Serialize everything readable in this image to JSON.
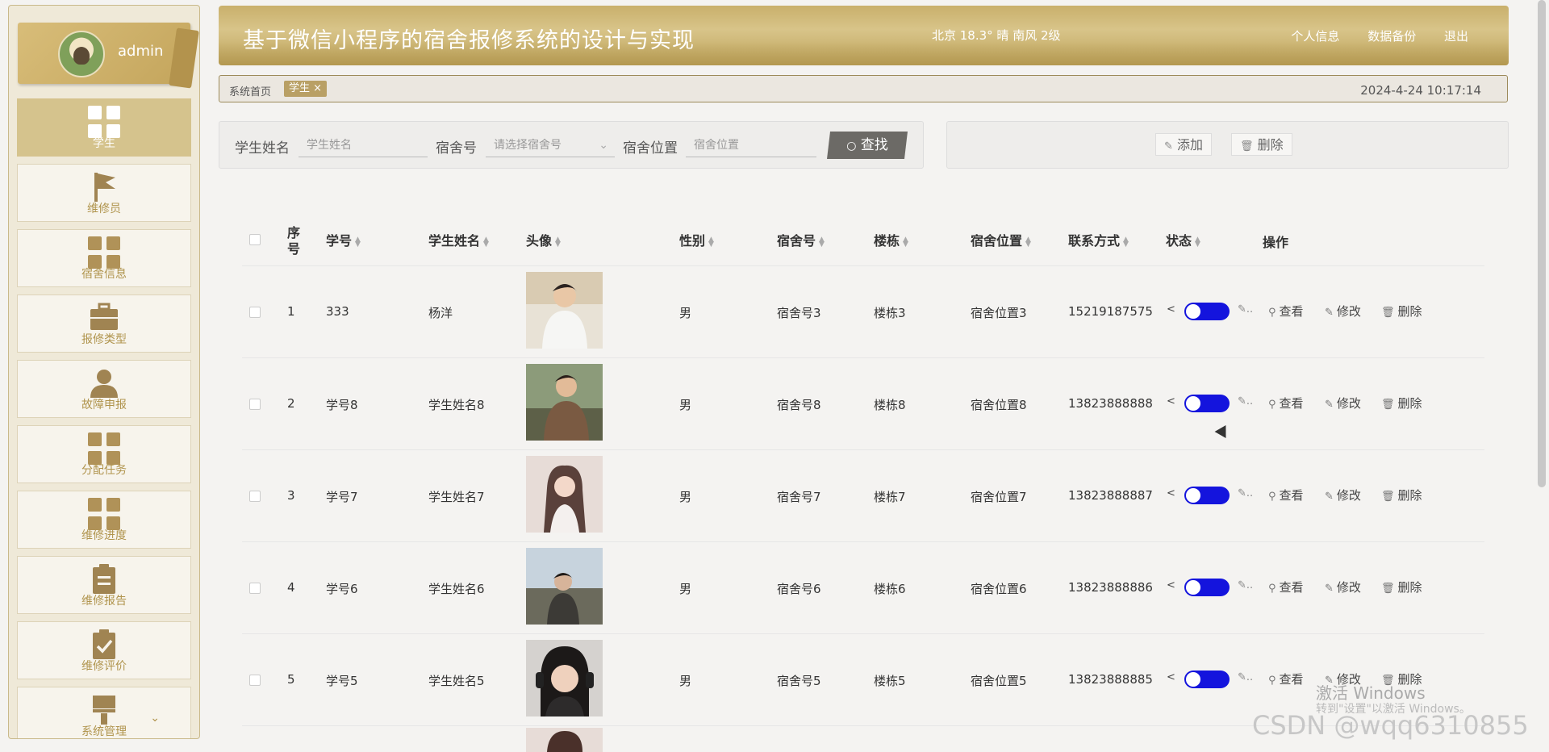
{
  "sidebar": {
    "username": "admin",
    "items": [
      {
        "label": "学生",
        "icon": "grid-icon",
        "active": true
      },
      {
        "label": "维修员",
        "icon": "flag-icon"
      },
      {
        "label": "宿舍信息",
        "icon": "grid-icon"
      },
      {
        "label": "报修类型",
        "icon": "briefcase-icon"
      },
      {
        "label": "故障申报",
        "icon": "user-icon"
      },
      {
        "label": "分配任务",
        "icon": "grid-icon"
      },
      {
        "label": "维修进度",
        "icon": "grid-icon"
      },
      {
        "label": "维修报告",
        "icon": "clipboard-icon"
      },
      {
        "label": "维修评价",
        "icon": "clipboard-check-icon"
      },
      {
        "label": "系统管理",
        "icon": "brush-icon"
      }
    ]
  },
  "header": {
    "title": "基于微信小程序的宿舍报修系统的设计与实现",
    "weather": "北京  18.3°  晴  南风  2级",
    "links": [
      "个人信息",
      "数据备份",
      "退出"
    ]
  },
  "tags": {
    "home": "系统首页",
    "active": "学生 ×",
    "datetime": "2024-4-24 10:17:14"
  },
  "search": {
    "name_label": "学生姓名",
    "name_placeholder": "学生姓名",
    "dorm_label": "宿舍号",
    "dorm_placeholder": "请选择宿舍号",
    "loc_label": "宿舍位置",
    "loc_placeholder": "宿舍位置",
    "find_label": "查找"
  },
  "actions": {
    "add": "添加",
    "delete": "删除"
  },
  "table": {
    "headers": [
      "序号",
      "学号",
      "学生姓名",
      "头像",
      "性别",
      "宿舍号",
      "楼栋",
      "宿舍位置",
      "联系方式",
      "状态",
      "操作"
    ],
    "ops": [
      "查看",
      "修改",
      "删除"
    ],
    "rows": [
      {
        "no": "1",
        "id": "333",
        "name": "杨洋",
        "gender": "男",
        "dorm": "宿舍号3",
        "building": "楼栋3",
        "location": "宿舍位置3",
        "phone": "15219187575"
      },
      {
        "no": "2",
        "id": "学号8",
        "name": "学生姓名8",
        "gender": "男",
        "dorm": "宿舍号8",
        "building": "楼栋8",
        "location": "宿舍位置8",
        "phone": "13823888888"
      },
      {
        "no": "3",
        "id": "学号7",
        "name": "学生姓名7",
        "gender": "男",
        "dorm": "宿舍号7",
        "building": "楼栋7",
        "location": "宿舍位置7",
        "phone": "13823888887"
      },
      {
        "no": "4",
        "id": "学号6",
        "name": "学生姓名6",
        "gender": "男",
        "dorm": "宿舍号6",
        "building": "楼栋6",
        "location": "宿舍位置6",
        "phone": "13823888886"
      },
      {
        "no": "5",
        "id": "学号5",
        "name": "学生姓名5",
        "gender": "男",
        "dorm": "宿舍号5",
        "building": "楼栋5",
        "location": "宿舍位置5",
        "phone": "13823888885"
      }
    ]
  },
  "overlay": {
    "activate_title": "激活 Windows",
    "activate_sub": "转到\"设置\"以激活 Windows。",
    "csdn": "CSDN @wqq6310855"
  },
  "colors": {
    "accent": "#c4a55c",
    "toggle": "#1414dd"
  }
}
